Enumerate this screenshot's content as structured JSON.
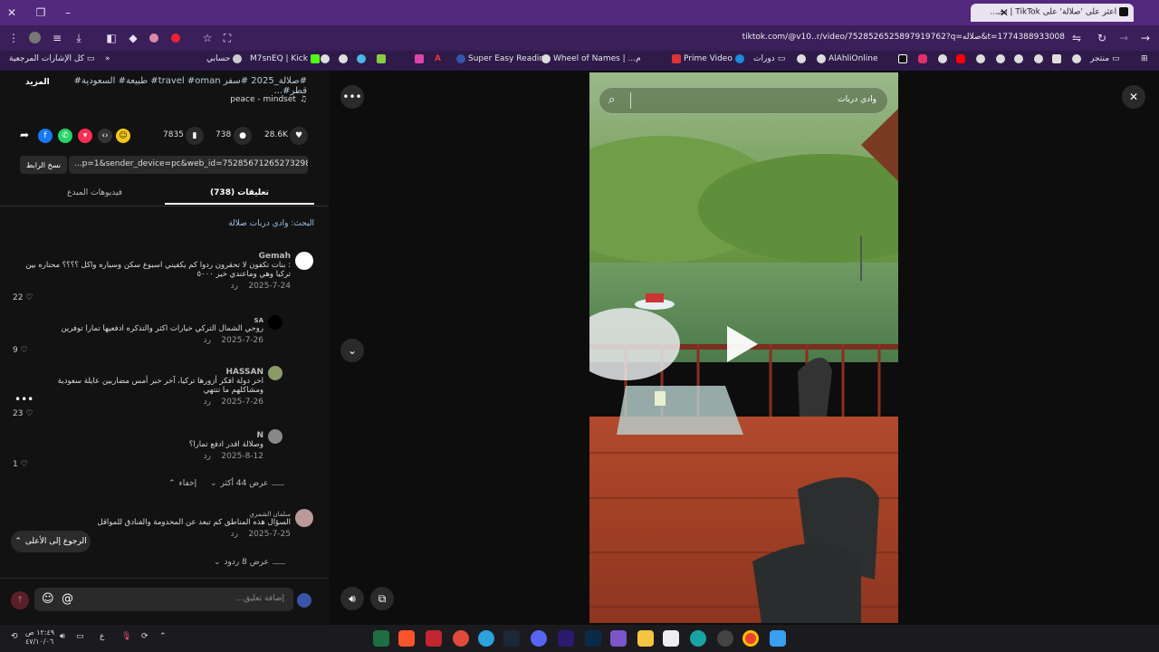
{
  "browser": {
    "tab_title": "اعثر على 'صلالة' على TikTok | بحـ...",
    "url": "tiktok.com/@v10..r/video/7528526525897919762?q=صلاله&t=1774388933008",
    "bookmarks": [
      "منتجر",
      "AlAhliOnline",
      "دورات",
      "Prime Video",
      "Wheel of Names | ...م",
      "Super Easy Reading",
      "M7snEQ | Kick",
      "حسابي",
      "كل الإشارات المرجعية"
    ]
  },
  "post": {
    "hashtags_line": "#صلالة_2025 #سفر travel #oman# طبيعة# السعودية# قطر#...",
    "more_label": "المزيد",
    "sound": "peace - mindset",
    "likes": "28.6K",
    "comments": "738",
    "saves": "7835",
    "link": "...p=1&sender_device=pc&web_id=7528567126527329810",
    "copy_link_label": "نسخ الرابط"
  },
  "tabs": {
    "comments": "تعليقات (738)",
    "creator_videos": "فيديوهات المبدع"
  },
  "search_hint": "البحث: وادي دربات صلالة",
  "comments": [
    {
      "name": "Gemah",
      "text": ": بنات تكفون لا تحقرون ردوا كم يكفيني اسبوع سكن وسياره واكل ؟؟؟؟ محتاره بين تركيا وهي وماعندي خير ٥٠٠٠",
      "date": "2025-7-24",
      "reply": "رد",
      "likes": "22"
    },
    {
      "name": "SA",
      "text": "روحي الشمال التركي خيارات اكثر والتذكره ادفعيها تمارا توفرين",
      "date": "2025-7-26",
      "reply": "رد",
      "likes": "9"
    },
    {
      "name": "HASSAN",
      "text": "اخر دولة افكر أزورها تركيا، آخر خبر أمس مضاربين عايلة سعودية ومشاكلهم ما تنتهي",
      "date": "2025-7-26",
      "reply": "رد",
      "likes": "23"
    },
    {
      "name": "N",
      "text": "وصلالة اقدر ادفع تمارا؟",
      "date": "2025-8-12",
      "reply": "رد",
      "likes": "1"
    },
    {
      "name": "سلمان الشمري",
      "text": "السؤال هذه المناطق كم تبعد عن المخدومة والفنادق للمواقل",
      "date": "2025-7-25",
      "reply": "رد",
      "likes": ""
    }
  ],
  "show_more_replies": "عرض 44 أكثر",
  "hide_label": "إخفاء",
  "show_replies": "عرض 8 ردود",
  "back_to_top": "الرجوع إلى الأعلى",
  "comment_placeholder": "إضافة تعليق...",
  "video_search_text": "وادي دربات",
  "taskbar": {
    "time": "١٢:٤٩ ص",
    "date": "٤٧/١٠/٠٦",
    "lang": "ع"
  },
  "colors": {
    "tab_bar": "#52297c",
    "toolbar": "#3a1f5a",
    "accent_red": "#fe2c55"
  }
}
